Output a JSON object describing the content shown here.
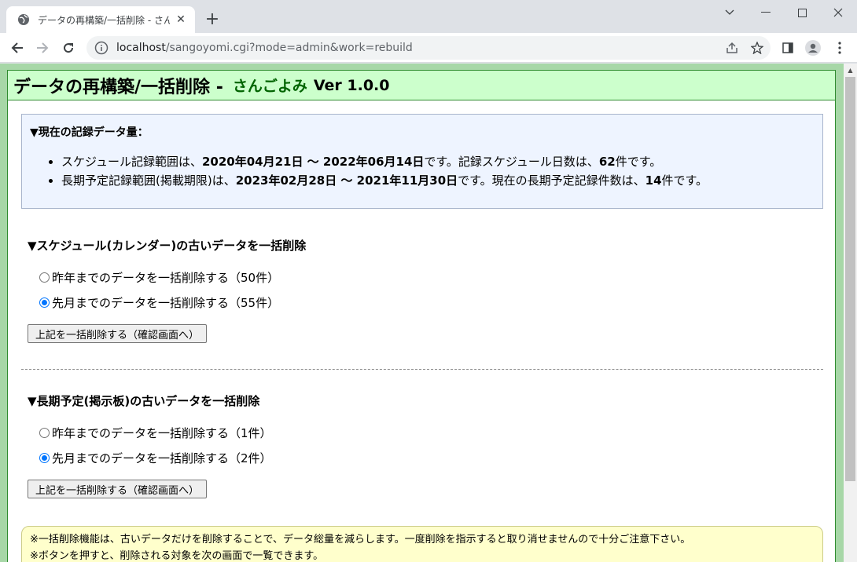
{
  "browser": {
    "tab_title": "データの再構築/一括削除 - さんごよみ",
    "url_host": "localhost",
    "url_path": "/sangoyomi.cgi?mode=admin&work=rebuild"
  },
  "header": {
    "title": "データの再構築/一括削除 -",
    "app_name": "さんごよみ",
    "version": "Ver 1.0.0"
  },
  "info": {
    "title": "▼現在の記録データ量：",
    "line1": {
      "prefix": "スケジュール記録範囲は、",
      "range": "2020年04月21日 ～ 2022年06月14日",
      "mid": "です。記録スケジュール日数は、",
      "count": "62",
      "suffix": "件です。"
    },
    "line2": {
      "prefix": "長期予定記録範囲(掲載期限)は、",
      "range": "2023年02月28日 ～ 2021年11月30日",
      "mid": "です。現在の長期予定記録件数は、",
      "count": "14",
      "suffix": "件です。"
    }
  },
  "schedule_section": {
    "title": "▼スケジュール(カレンダー)の古いデータを一括削除",
    "options": [
      {
        "label": "昨年までのデータを一括削除する（50件）",
        "checked": false
      },
      {
        "label": "先月までのデータを一括削除する（55件）",
        "checked": true
      }
    ],
    "button": "上記を一括削除する（確認画面へ）"
  },
  "longterm_section": {
    "title": "▼長期予定(掲示板)の古いデータを一括削除",
    "options": [
      {
        "label": "昨年までのデータを一括削除する（1件）",
        "checked": false
      },
      {
        "label": "先月までのデータを一括削除する（2件）",
        "checked": true
      }
    ],
    "button": "上記を一括削除する（確認画面へ）"
  },
  "notes": [
    "※一括削除機能は、古いデータだけを削除することで、データ総量を減らします。一度削除を指示すると取り消せませんので十分ご注意下さい。",
    "※ボタンを押すと、削除される対象を次の画面で一覧できます。"
  ]
}
